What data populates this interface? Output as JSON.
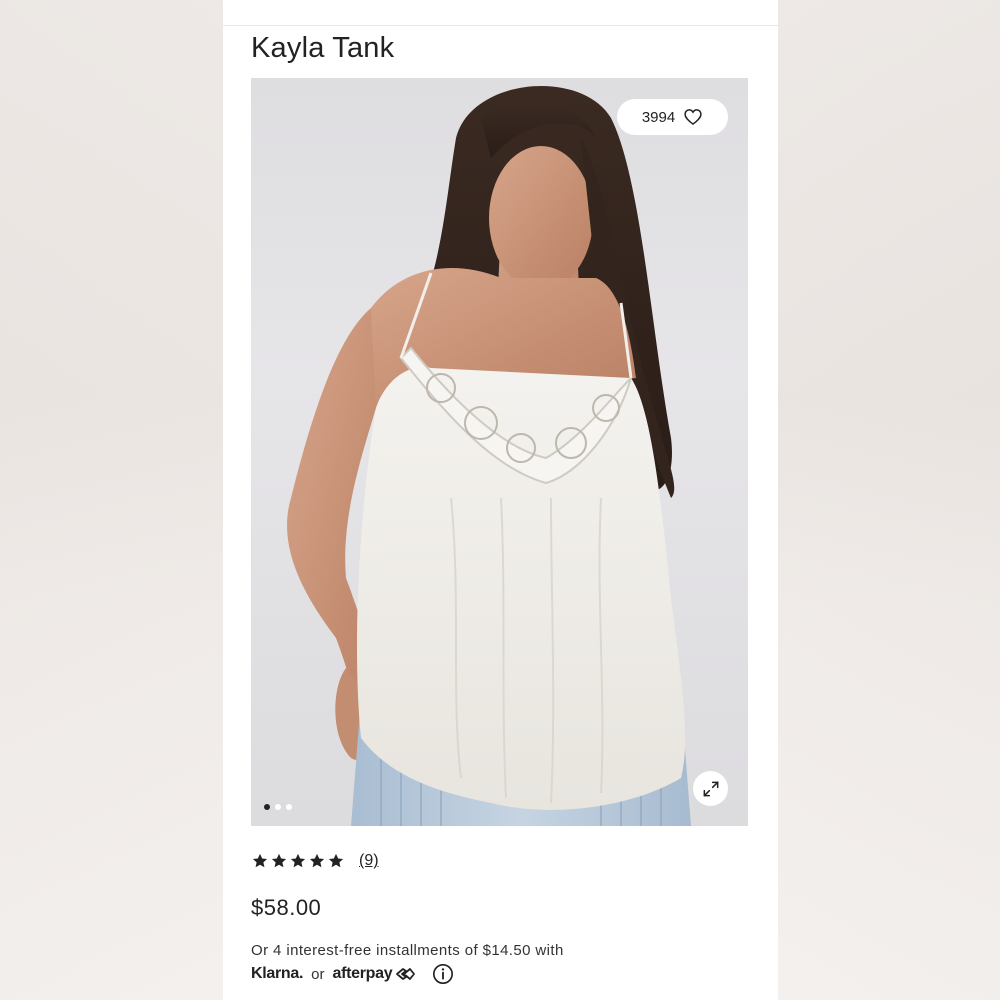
{
  "product": {
    "title": "Kayla Tank",
    "favorites_count": "3994",
    "rating_stars": 5,
    "review_count": "(9)",
    "price": "$58.00",
    "installments_text": "Or 4 interest-free installments of $14.50 with",
    "klarna_label": "Klarna.",
    "or_label": "or",
    "afterpay_label": "afterpay"
  },
  "gallery": {
    "image_count": 3,
    "active_index": 0,
    "icons": [
      "heart-icon",
      "expand-icon"
    ]
  },
  "colors": {
    "text": "#222222",
    "background": "#ffffff",
    "page_bg": "#f6f3f1"
  }
}
